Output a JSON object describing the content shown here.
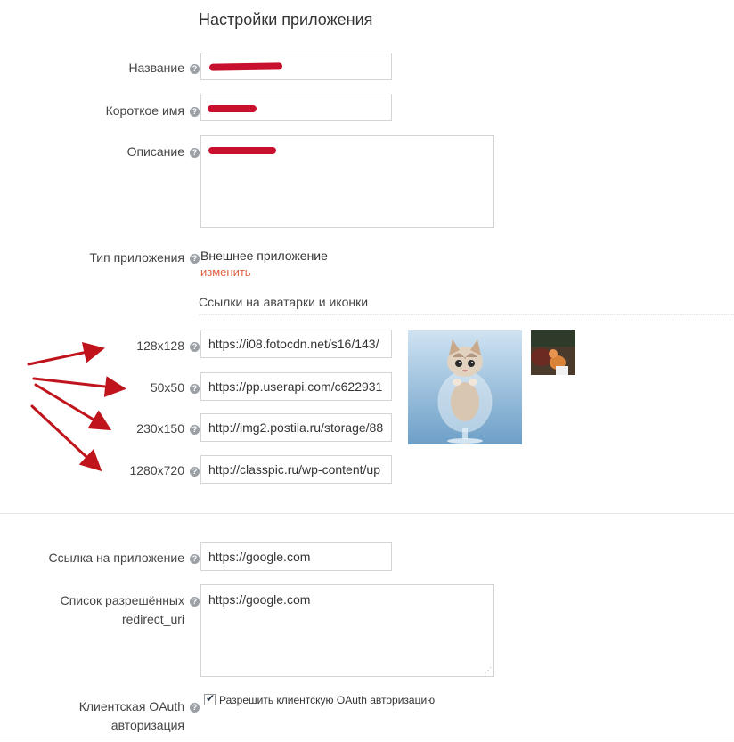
{
  "page_title": "Настройки приложения",
  "fields": {
    "name_label": "Название",
    "shortname_label": "Короткое имя",
    "description_label": "Описание",
    "apptype_label": "Тип приложения",
    "apptype_value": "Внешнее приложение",
    "apptype_change": "изменить"
  },
  "help_icon": "?",
  "icons_section": {
    "title": "Ссылки на аватарки и иконки",
    "rows": [
      {
        "label": "128x128",
        "value": "https://i08.fotocdn.net/s16/143/"
      },
      {
        "label": "50x50",
        "value": "https://pp.userapi.com/c622931"
      },
      {
        "label": "230x150",
        "value": "http://img2.postila.ru/storage/88"
      },
      {
        "label": "1280x720",
        "value": "http://classpic.ru/wp-content/up"
      }
    ]
  },
  "app_link": {
    "label": "Ссылка на приложение",
    "value": "https://google.com"
  },
  "redirect": {
    "label_line1": "Список разрешённых",
    "label_line2": "redirect_uri",
    "value": "https://google.com"
  },
  "oauth": {
    "label_line1": "Клиентская OAuth",
    "label_line2": "авторизация",
    "checkbox_label": "Разрешить клиентскую OAuth авторизацию",
    "checked": true
  },
  "colors": {
    "arrow": "#c0141c",
    "redaction": "#c8102e",
    "link": "#e06040"
  }
}
